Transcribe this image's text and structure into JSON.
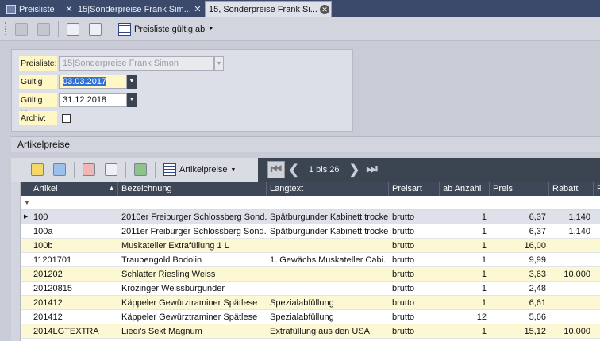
{
  "tabs": [
    {
      "label": "Preisliste",
      "active": false
    },
    {
      "label": "15|Sonderpreise Frank Sim...",
      "active": false
    },
    {
      "label": "15, Sonderpreise Frank Si...",
      "active": true
    }
  ],
  "toolbar": {
    "pricelist_validity_label": "Preisliste gültig ab"
  },
  "form": {
    "preisliste_label": "Preisliste:",
    "preisliste_value": "15|Sonderpreise Frank Simon",
    "gueltig_von_label": "Gültig von:",
    "gueltig_von_value": "03.03.2017",
    "gueltig_bis_label": "Gültig bis:",
    "gueltig_bis_value": "31.12.2018",
    "archiv_label": "Archiv:"
  },
  "section": {
    "title": "Artikelpreise",
    "artikelpreise_button": "Artikelpreise"
  },
  "navigation": {
    "range": "1 bis 26"
  },
  "table": {
    "columns": [
      "Artikel",
      "Bezeichnung",
      "Langtext",
      "Preisart",
      "ab Anzahl",
      "Preis",
      "Rabatt",
      "R"
    ],
    "rows": [
      [
        "100",
        "2010er Freiburger Schlossberg Sond...",
        "Spätburgunder Kabinett trocken",
        "brutto",
        "1",
        "6,37",
        "1,140"
      ],
      [
        "100a",
        "2011er Freiburger Schlossberg Sond...",
        "Spätburgunder Kabinett trocken",
        "brutto",
        "1",
        "6,37",
        "1,140"
      ],
      [
        "100b",
        "Muskateller Extrafüllung 1 L",
        "",
        "brutto",
        "1",
        "16,00",
        ""
      ],
      [
        "11201701",
        "Traubengold Bodolin",
        "1. Gewächs Muskateller Cabi...",
        "brutto",
        "1",
        "9,99",
        ""
      ],
      [
        "201202",
        "Schlatter Riesling Weiss",
        "",
        "brutto",
        "1",
        "3,63",
        "10,000"
      ],
      [
        "20120815",
        "Krozinger Weissburgunder",
        "",
        "brutto",
        "1",
        "2,48",
        ""
      ],
      [
        "201412",
        "Käppeler Gewürztraminer Spätlese",
        "Spezialabfüllung",
        "brutto",
        "1",
        "6,61",
        ""
      ],
      [
        "201412",
        "Käppeler Gewürztraminer Spätlese",
        "Spezialabfüllung",
        "brutto",
        "12",
        "5,66",
        ""
      ],
      [
        "2014LGTEXTRA",
        "Liedi's Sekt Magnum",
        "Extrafüllung aus den USA",
        "brutto",
        "1",
        "15,12",
        "10,000"
      ]
    ]
  }
}
